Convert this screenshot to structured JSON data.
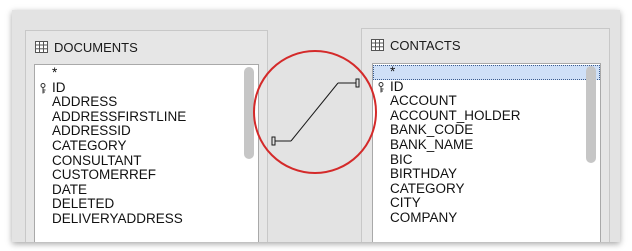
{
  "documents_table": {
    "title": "DOCUMENTS",
    "icon": "table-grid-icon",
    "fields": [
      {
        "name": "*",
        "key": false
      },
      {
        "name": "ID",
        "key": true
      },
      {
        "name": "ADDRESS",
        "key": false
      },
      {
        "name": "ADDRESSFIRSTLINE",
        "key": false
      },
      {
        "name": "ADDRESSID",
        "key": false
      },
      {
        "name": "CATEGORY",
        "key": false
      },
      {
        "name": "CONSULTANT",
        "key": false
      },
      {
        "name": "CUSTOMERREF",
        "key": false
      },
      {
        "name": "DATE",
        "key": false
      },
      {
        "name": "DELETED",
        "key": false
      },
      {
        "name": "DELIVERYADDRESS",
        "key": false
      }
    ]
  },
  "contacts_table": {
    "title": "CONTACTS",
    "icon": "table-grid-icon",
    "fields": [
      {
        "name": "*",
        "key": false,
        "selected": true
      },
      {
        "name": "ID",
        "key": true
      },
      {
        "name": "ACCOUNT",
        "key": false
      },
      {
        "name": "ACCOUNT_HOLDER",
        "key": false
      },
      {
        "name": "BANK_CODE",
        "key": false
      },
      {
        "name": "BANK_NAME",
        "key": false
      },
      {
        "name": "BIC",
        "key": false
      },
      {
        "name": "BIRTHDAY",
        "key": false
      },
      {
        "name": "CATEGORY",
        "key": false
      },
      {
        "name": "CITY",
        "key": false
      },
      {
        "name": "COMPANY",
        "key": false
      }
    ]
  },
  "relation": {
    "from": "DOCUMENTS",
    "to": "CONTACTS.ID",
    "highlight_color": "#d42a2a",
    "line_color": "#1a1a1a"
  },
  "colors": {
    "background": "#e3e3e3",
    "list_background": "#ffffff",
    "selection": "#cfe0f7"
  }
}
